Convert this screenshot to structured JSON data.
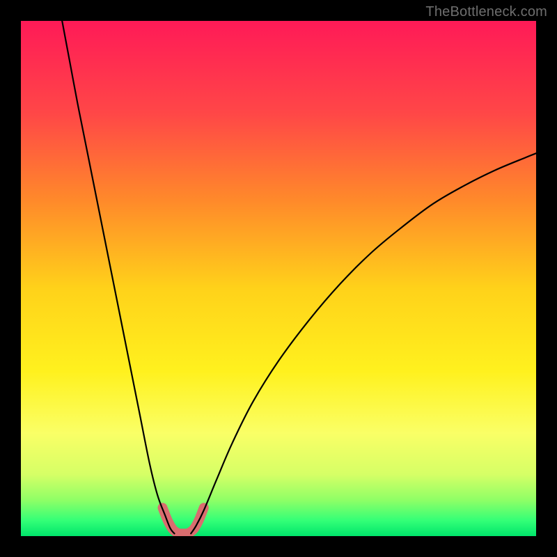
{
  "watermark": {
    "text": "TheBottleneck.com"
  },
  "chart_data": {
    "type": "line",
    "title": "",
    "xlabel": "",
    "ylabel": "",
    "xlim": [
      0,
      100
    ],
    "ylim": [
      0,
      100
    ],
    "gradient_stops": [
      {
        "offset": 0,
        "color": "#ff1a57"
      },
      {
        "offset": 18,
        "color": "#ff4747"
      },
      {
        "offset": 35,
        "color": "#ff8a2a"
      },
      {
        "offset": 52,
        "color": "#ffd21a"
      },
      {
        "offset": 68,
        "color": "#fff11e"
      },
      {
        "offset": 80,
        "color": "#faff66"
      },
      {
        "offset": 88,
        "color": "#d6ff66"
      },
      {
        "offset": 93,
        "color": "#8fff66"
      },
      {
        "offset": 97,
        "color": "#33ff77"
      },
      {
        "offset": 100,
        "color": "#00e56b"
      }
    ],
    "series": [
      {
        "name": "bottleneck-curve-left",
        "x": [
          8.0,
          9.5,
          11.0,
          13.0,
          15.0,
          17.0,
          19.0,
          21.0,
          23.0,
          25.0,
          26.5,
          28.0,
          29.0,
          29.8
        ],
        "y": [
          100,
          92,
          84,
          74,
          64,
          54,
          44,
          34,
          24,
          14,
          8,
          4,
          1.5,
          0.5
        ]
      },
      {
        "name": "bottleneck-curve-right",
        "x": [
          33.0,
          34.0,
          35.5,
          38.0,
          41.0,
          45.0,
          50.0,
          56.0,
          62.0,
          68.0,
          74.0,
          80.0,
          86.0,
          92.0,
          98.0,
          100.0
        ],
        "y": [
          0.5,
          2.0,
          5.0,
          11.0,
          18.0,
          26.0,
          34.0,
          42.0,
          49.0,
          55.0,
          60.0,
          64.5,
          68.0,
          71.0,
          73.5,
          74.3
        ]
      },
      {
        "name": "minimum-highlight",
        "x": [
          27.5,
          28.5,
          29.5,
          30.5,
          31.5,
          32.5,
          33.5,
          34.5,
          35.5
        ],
        "y": [
          5.5,
          3.0,
          1.3,
          0.6,
          0.5,
          0.6,
          1.3,
          3.0,
          5.5
        ]
      }
    ]
  }
}
